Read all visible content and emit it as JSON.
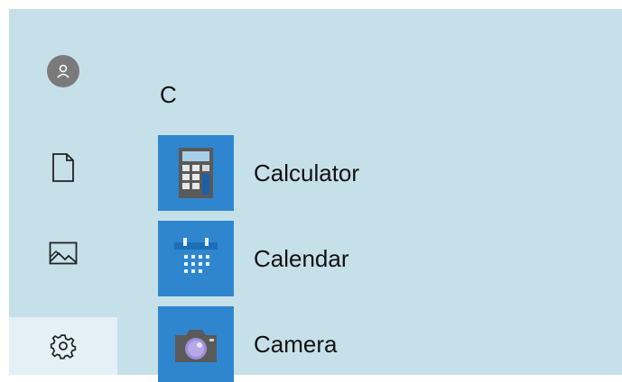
{
  "rail": {
    "items": [
      {
        "id": "account",
        "icon": "user-avatar-icon"
      },
      {
        "id": "documents",
        "icon": "document-icon"
      },
      {
        "id": "pictures",
        "icon": "pictures-icon"
      },
      {
        "id": "settings",
        "icon": "gear-icon",
        "selected": true
      }
    ]
  },
  "app_list": {
    "group_letter": "C",
    "apps": [
      {
        "label": "Calculator",
        "icon": "calculator-icon"
      },
      {
        "label": "Calendar",
        "icon": "calendar-icon"
      },
      {
        "label": "Camera",
        "icon": "camera-icon"
      }
    ]
  },
  "colors": {
    "panel_background": "#c6e0ea",
    "selected_background": "#e3f0f5",
    "tile_blue": "#2f86cf"
  }
}
